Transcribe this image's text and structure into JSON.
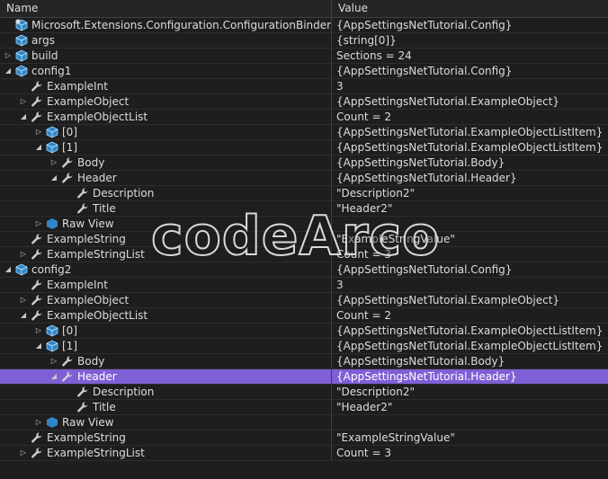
{
  "header": {
    "name_label": "Name",
    "value_label": "Value"
  },
  "watermark": "codeArco",
  "rows": [
    {
      "level": 0,
      "exp": "none",
      "icon": "eval-icon",
      "name": "Microsoft.Extensions.Configuration.ConfigurationBinder.Ge...",
      "value": "{AppSettingsNetTutorial.Config}"
    },
    {
      "level": 0,
      "exp": "none",
      "icon": "object-icon",
      "name": "args",
      "value": "{string[0]}"
    },
    {
      "level": 0,
      "exp": "collapsed",
      "icon": "object-icon",
      "name": "build",
      "value": "Sections = 24"
    },
    {
      "level": 0,
      "exp": "expanded",
      "icon": "object-icon",
      "name": "config1",
      "value": "{AppSettingsNetTutorial.Config}"
    },
    {
      "level": 1,
      "exp": "none",
      "icon": "wrench-icon",
      "name": "ExampleInt",
      "value": "3"
    },
    {
      "level": 1,
      "exp": "collapsed",
      "icon": "wrench-icon",
      "name": "ExampleObject",
      "value": "{AppSettingsNetTutorial.ExampleObject}"
    },
    {
      "level": 1,
      "exp": "expanded",
      "icon": "wrench-icon",
      "name": "ExampleObjectList",
      "value": "Count = 2"
    },
    {
      "level": 2,
      "exp": "collapsed",
      "icon": "object-icon",
      "name": "[0]",
      "value": "{AppSettingsNetTutorial.ExampleObjectListItem}"
    },
    {
      "level": 2,
      "exp": "expanded",
      "icon": "object-icon",
      "name": "[1]",
      "value": "{AppSettingsNetTutorial.ExampleObjectListItem}"
    },
    {
      "level": 3,
      "exp": "collapsed",
      "icon": "wrench-icon",
      "name": "Body",
      "value": "{AppSettingsNetTutorial.Body}"
    },
    {
      "level": 3,
      "exp": "expanded",
      "icon": "wrench-icon",
      "name": "Header",
      "value": "{AppSettingsNetTutorial.Header}"
    },
    {
      "level": 4,
      "exp": "none",
      "icon": "wrench-icon",
      "name": "Description",
      "value": "\"Description2\""
    },
    {
      "level": 4,
      "exp": "none",
      "icon": "wrench-icon",
      "name": "Title",
      "value": "\"Header2\""
    },
    {
      "level": 2,
      "exp": "collapsed",
      "icon": "rawview-icon",
      "name": "Raw View",
      "value": ""
    },
    {
      "level": 1,
      "exp": "none",
      "icon": "wrench-icon",
      "name": "ExampleString",
      "value": "\"ExampleStringValue\""
    },
    {
      "level": 1,
      "exp": "collapsed",
      "icon": "wrench-icon",
      "name": "ExampleStringList",
      "value": "Count = 3"
    },
    {
      "level": 0,
      "exp": "expanded",
      "icon": "object-icon",
      "name": "config2",
      "value": "{AppSettingsNetTutorial.Config}"
    },
    {
      "level": 1,
      "exp": "none",
      "icon": "wrench-icon",
      "name": "ExampleInt",
      "value": "3"
    },
    {
      "level": 1,
      "exp": "collapsed",
      "icon": "wrench-icon",
      "name": "ExampleObject",
      "value": "{AppSettingsNetTutorial.ExampleObject}"
    },
    {
      "level": 1,
      "exp": "expanded",
      "icon": "wrench-icon",
      "name": "ExampleObjectList",
      "value": "Count = 2"
    },
    {
      "level": 2,
      "exp": "collapsed",
      "icon": "object-icon",
      "name": "[0]",
      "value": "{AppSettingsNetTutorial.ExampleObjectListItem}"
    },
    {
      "level": 2,
      "exp": "expanded",
      "icon": "object-icon",
      "name": "[1]",
      "value": "{AppSettingsNetTutorial.ExampleObjectListItem}"
    },
    {
      "level": 3,
      "exp": "collapsed",
      "icon": "wrench-icon",
      "name": "Body",
      "value": "{AppSettingsNetTutorial.Body}"
    },
    {
      "level": 3,
      "exp": "expanded",
      "icon": "wrench-icon",
      "name": "Header",
      "value": "{AppSettingsNetTutorial.Header}",
      "selected": true
    },
    {
      "level": 4,
      "exp": "none",
      "icon": "wrench-icon",
      "name": "Description",
      "value": "\"Description2\""
    },
    {
      "level": 4,
      "exp": "none",
      "icon": "wrench-icon",
      "name": "Title",
      "value": "\"Header2\""
    },
    {
      "level": 2,
      "exp": "collapsed",
      "icon": "rawview-icon",
      "name": "Raw View",
      "value": ""
    },
    {
      "level": 1,
      "exp": "none",
      "icon": "wrench-icon",
      "name": "ExampleString",
      "value": "\"ExampleStringValue\""
    },
    {
      "level": 1,
      "exp": "collapsed",
      "icon": "wrench-icon",
      "name": "ExampleStringList",
      "value": "Count = 3"
    }
  ],
  "colors": {
    "background": "#1e1e1e",
    "selected_row": "#7f5fd6",
    "object_icon": "#2f87c8",
    "wrench_icon": "#d0d0d0",
    "text": "#dcdcdc"
  }
}
